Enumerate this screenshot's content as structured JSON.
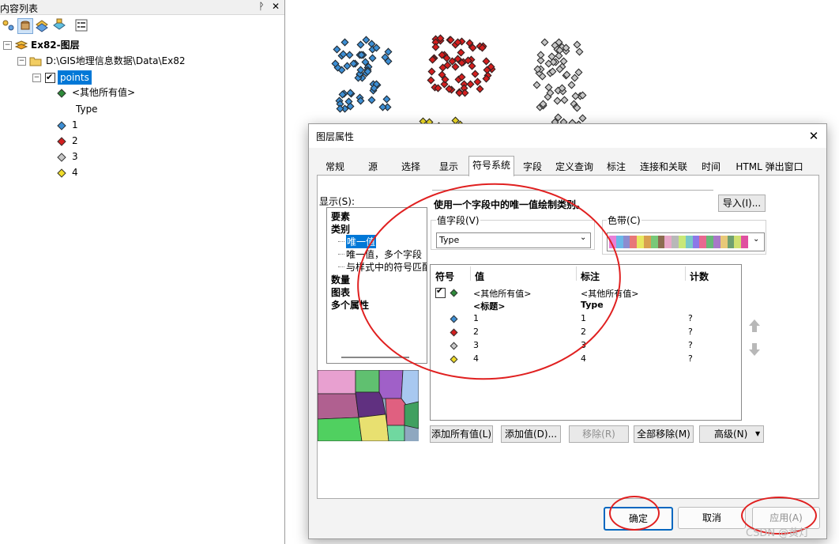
{
  "toc": {
    "title": "内容列表",
    "pin_glyph": "ᚹ",
    "close_glyph": "✕",
    "data_frame": "Ex82-图层",
    "folder": "D:\\GIS地理信息数据\\Data\\Ex82",
    "layer": "points",
    "legend_items": [
      {
        "label": "<其他所有值>",
        "color": "#2e8b3a"
      },
      {
        "label": "Type",
        "color": ""
      },
      {
        "label": "1",
        "color": "#3c8ed4"
      },
      {
        "label": "2",
        "color": "#d41e1e"
      },
      {
        "label": "3",
        "color": "#c8c8c8"
      },
      {
        "label": "4",
        "color": "#f0dc28"
      }
    ]
  },
  "dialog": {
    "title": "图层属性",
    "close_glyph": "✕",
    "tabs": [
      "常规",
      "源",
      "选择",
      "显示",
      "符号系统",
      "字段",
      "定义查询",
      "标注",
      "连接和关联",
      "时间",
      "HTML 弹出窗口"
    ],
    "active_tab": "符号系统",
    "show_label": "显示(S):",
    "show_items": [
      {
        "label": "要素",
        "bold": true
      },
      {
        "label": "类别",
        "bold": true
      },
      {
        "label": "唯一值",
        "bold": false,
        "selected": true
      },
      {
        "label": "唯一值，多个字段",
        "bold": false
      },
      {
        "label": "与样式中的符号匹配",
        "bold": false
      },
      {
        "label": "数量",
        "bold": true
      },
      {
        "label": "图表",
        "bold": true
      },
      {
        "label": "多个属性",
        "bold": true
      }
    ],
    "description": "使用一个字段中的唯一值绘制类别。",
    "import_button": "导入(I)...",
    "value_field_label": "值字段(V)",
    "value_field_value": "Type",
    "color_ramp_label": "色带(C)",
    "color_ramp": [
      "#e880d8",
      "#6bb8e8",
      "#8c8cd0",
      "#e87878",
      "#e8e860",
      "#d8a050",
      "#78c878",
      "#8c6c50",
      "#e8a8c8",
      "#b8b8b8",
      "#c8e878",
      "#78c8c8",
      "#8c78e8",
      "#e86890",
      "#68b878",
      "#a878c8",
      "#e8c878",
      "#70a070",
      "#d0e070",
      "#e050a0"
    ],
    "table": {
      "headers": [
        "符号",
        "值",
        "标注",
        "计数"
      ],
      "rows": [
        {
          "value": "<其他所有值>",
          "label": "<其他所有值>",
          "count": "",
          "color": "#2e8b3a",
          "checkbox": true
        },
        {
          "value": "<标题>",
          "label": "Type",
          "count": "",
          "color": "",
          "heading": true
        },
        {
          "value": "1",
          "label": "1",
          "count": "?",
          "color": "#3c8ed4"
        },
        {
          "value": "2",
          "label": "2",
          "count": "?",
          "color": "#d41e1e"
        },
        {
          "value": "3",
          "label": "3",
          "count": "?",
          "color": "#c8c8c8"
        },
        {
          "value": "4",
          "label": "4",
          "count": "?",
          "color": "#f0dc28"
        }
      ]
    },
    "buttons": {
      "add_all": "添加所有值(L)",
      "add_values": "添加值(D)...",
      "remove": "移除(R)",
      "remove_all": "全部移除(M)",
      "advanced": "高级(N)",
      "ok": "确定",
      "cancel": "取消",
      "apply": "应用(A)"
    }
  },
  "watermark": "CSDN @黄灯"
}
